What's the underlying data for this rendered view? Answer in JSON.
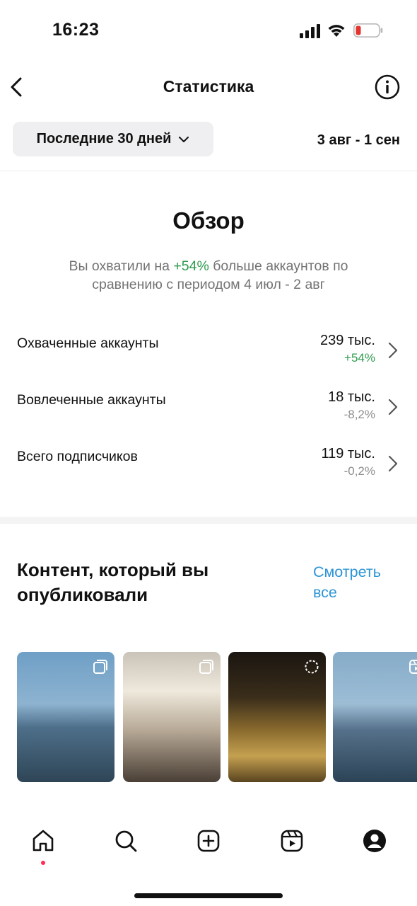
{
  "status_bar": {
    "time": "16:23",
    "icons": [
      "cellular-signal-icon",
      "wifi-icon",
      "battery-low-icon"
    ],
    "battery_color": "#e5342f"
  },
  "header": {
    "title": "Статистика",
    "back_icon": "chevron-left-icon",
    "info_icon": "info-icon"
  },
  "filter": {
    "period_label": "Последние 30 дней",
    "date_range": "3 авг - 1 сен"
  },
  "overview": {
    "title": "Обзор",
    "desc_prefix": "Вы охватили на ",
    "desc_highlight": "+54%",
    "desc_suffix": " больше аккаунтов по сравнению с периодом 4 июл - 2 авг",
    "metrics": [
      {
        "label": "Охваченные аккаунты",
        "value": "239 тыс.",
        "change": "+54%",
        "trend": "up"
      },
      {
        "label": "Вовлеченные аккаунты",
        "value": "18 тыс.",
        "change": "-8,2%",
        "trend": "down"
      },
      {
        "label": "Всего подписчиков",
        "value": "119 тыс.",
        "change": "-0,2%",
        "trend": "down"
      }
    ]
  },
  "content": {
    "title": "Контент, который вы опубликовали",
    "see_all": "Смотреть все",
    "thumbnails": [
      {
        "type": "carousel"
      },
      {
        "type": "carousel"
      },
      {
        "type": "story"
      },
      {
        "type": "reel"
      }
    ]
  },
  "tabbar": {
    "items": [
      "home-icon",
      "search-icon",
      "create-icon",
      "reels-icon",
      "profile-icon"
    ]
  },
  "colors": {
    "positive": "#2e9b4d",
    "neutral": "#8e8e8e",
    "link": "#2d95d6",
    "notification_dot": "#ff2d55"
  }
}
